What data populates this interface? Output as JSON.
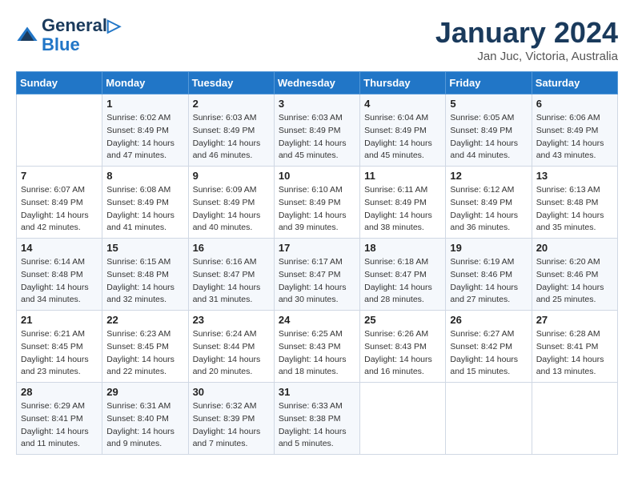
{
  "logo": {
    "line1": "General",
    "line2": "Blue"
  },
  "title": "January 2024",
  "subtitle": "Jan Juc, Victoria, Australia",
  "header": {
    "days": [
      "Sunday",
      "Monday",
      "Tuesday",
      "Wednesday",
      "Thursday",
      "Friday",
      "Saturday"
    ]
  },
  "weeks": [
    [
      {
        "num": "",
        "info": ""
      },
      {
        "num": "1",
        "info": "Sunrise: 6:02 AM\nSunset: 8:49 PM\nDaylight: 14 hours\nand 47 minutes."
      },
      {
        "num": "2",
        "info": "Sunrise: 6:03 AM\nSunset: 8:49 PM\nDaylight: 14 hours\nand 46 minutes."
      },
      {
        "num": "3",
        "info": "Sunrise: 6:03 AM\nSunset: 8:49 PM\nDaylight: 14 hours\nand 45 minutes."
      },
      {
        "num": "4",
        "info": "Sunrise: 6:04 AM\nSunset: 8:49 PM\nDaylight: 14 hours\nand 45 minutes."
      },
      {
        "num": "5",
        "info": "Sunrise: 6:05 AM\nSunset: 8:49 PM\nDaylight: 14 hours\nand 44 minutes."
      },
      {
        "num": "6",
        "info": "Sunrise: 6:06 AM\nSunset: 8:49 PM\nDaylight: 14 hours\nand 43 minutes."
      }
    ],
    [
      {
        "num": "7",
        "info": "Sunrise: 6:07 AM\nSunset: 8:49 PM\nDaylight: 14 hours\nand 42 minutes."
      },
      {
        "num": "8",
        "info": "Sunrise: 6:08 AM\nSunset: 8:49 PM\nDaylight: 14 hours\nand 41 minutes."
      },
      {
        "num": "9",
        "info": "Sunrise: 6:09 AM\nSunset: 8:49 PM\nDaylight: 14 hours\nand 40 minutes."
      },
      {
        "num": "10",
        "info": "Sunrise: 6:10 AM\nSunset: 8:49 PM\nDaylight: 14 hours\nand 39 minutes."
      },
      {
        "num": "11",
        "info": "Sunrise: 6:11 AM\nSunset: 8:49 PM\nDaylight: 14 hours\nand 38 minutes."
      },
      {
        "num": "12",
        "info": "Sunrise: 6:12 AM\nSunset: 8:49 PM\nDaylight: 14 hours\nand 36 minutes."
      },
      {
        "num": "13",
        "info": "Sunrise: 6:13 AM\nSunset: 8:48 PM\nDaylight: 14 hours\nand 35 minutes."
      }
    ],
    [
      {
        "num": "14",
        "info": "Sunrise: 6:14 AM\nSunset: 8:48 PM\nDaylight: 14 hours\nand 34 minutes."
      },
      {
        "num": "15",
        "info": "Sunrise: 6:15 AM\nSunset: 8:48 PM\nDaylight: 14 hours\nand 32 minutes."
      },
      {
        "num": "16",
        "info": "Sunrise: 6:16 AM\nSunset: 8:47 PM\nDaylight: 14 hours\nand 31 minutes."
      },
      {
        "num": "17",
        "info": "Sunrise: 6:17 AM\nSunset: 8:47 PM\nDaylight: 14 hours\nand 30 minutes."
      },
      {
        "num": "18",
        "info": "Sunrise: 6:18 AM\nSunset: 8:47 PM\nDaylight: 14 hours\nand 28 minutes."
      },
      {
        "num": "19",
        "info": "Sunrise: 6:19 AM\nSunset: 8:46 PM\nDaylight: 14 hours\nand 27 minutes."
      },
      {
        "num": "20",
        "info": "Sunrise: 6:20 AM\nSunset: 8:46 PM\nDaylight: 14 hours\nand 25 minutes."
      }
    ],
    [
      {
        "num": "21",
        "info": "Sunrise: 6:21 AM\nSunset: 8:45 PM\nDaylight: 14 hours\nand 23 minutes."
      },
      {
        "num": "22",
        "info": "Sunrise: 6:23 AM\nSunset: 8:45 PM\nDaylight: 14 hours\nand 22 minutes."
      },
      {
        "num": "23",
        "info": "Sunrise: 6:24 AM\nSunset: 8:44 PM\nDaylight: 14 hours\nand 20 minutes."
      },
      {
        "num": "24",
        "info": "Sunrise: 6:25 AM\nSunset: 8:43 PM\nDaylight: 14 hours\nand 18 minutes."
      },
      {
        "num": "25",
        "info": "Sunrise: 6:26 AM\nSunset: 8:43 PM\nDaylight: 14 hours\nand 16 minutes."
      },
      {
        "num": "26",
        "info": "Sunrise: 6:27 AM\nSunset: 8:42 PM\nDaylight: 14 hours\nand 15 minutes."
      },
      {
        "num": "27",
        "info": "Sunrise: 6:28 AM\nSunset: 8:41 PM\nDaylight: 14 hours\nand 13 minutes."
      }
    ],
    [
      {
        "num": "28",
        "info": "Sunrise: 6:29 AM\nSunset: 8:41 PM\nDaylight: 14 hours\nand 11 minutes."
      },
      {
        "num": "29",
        "info": "Sunrise: 6:31 AM\nSunset: 8:40 PM\nDaylight: 14 hours\nand 9 minutes."
      },
      {
        "num": "30",
        "info": "Sunrise: 6:32 AM\nSunset: 8:39 PM\nDaylight: 14 hours\nand 7 minutes."
      },
      {
        "num": "31",
        "info": "Sunrise: 6:33 AM\nSunset: 8:38 PM\nDaylight: 14 hours\nand 5 minutes."
      },
      {
        "num": "",
        "info": ""
      },
      {
        "num": "",
        "info": ""
      },
      {
        "num": "",
        "info": ""
      }
    ]
  ]
}
